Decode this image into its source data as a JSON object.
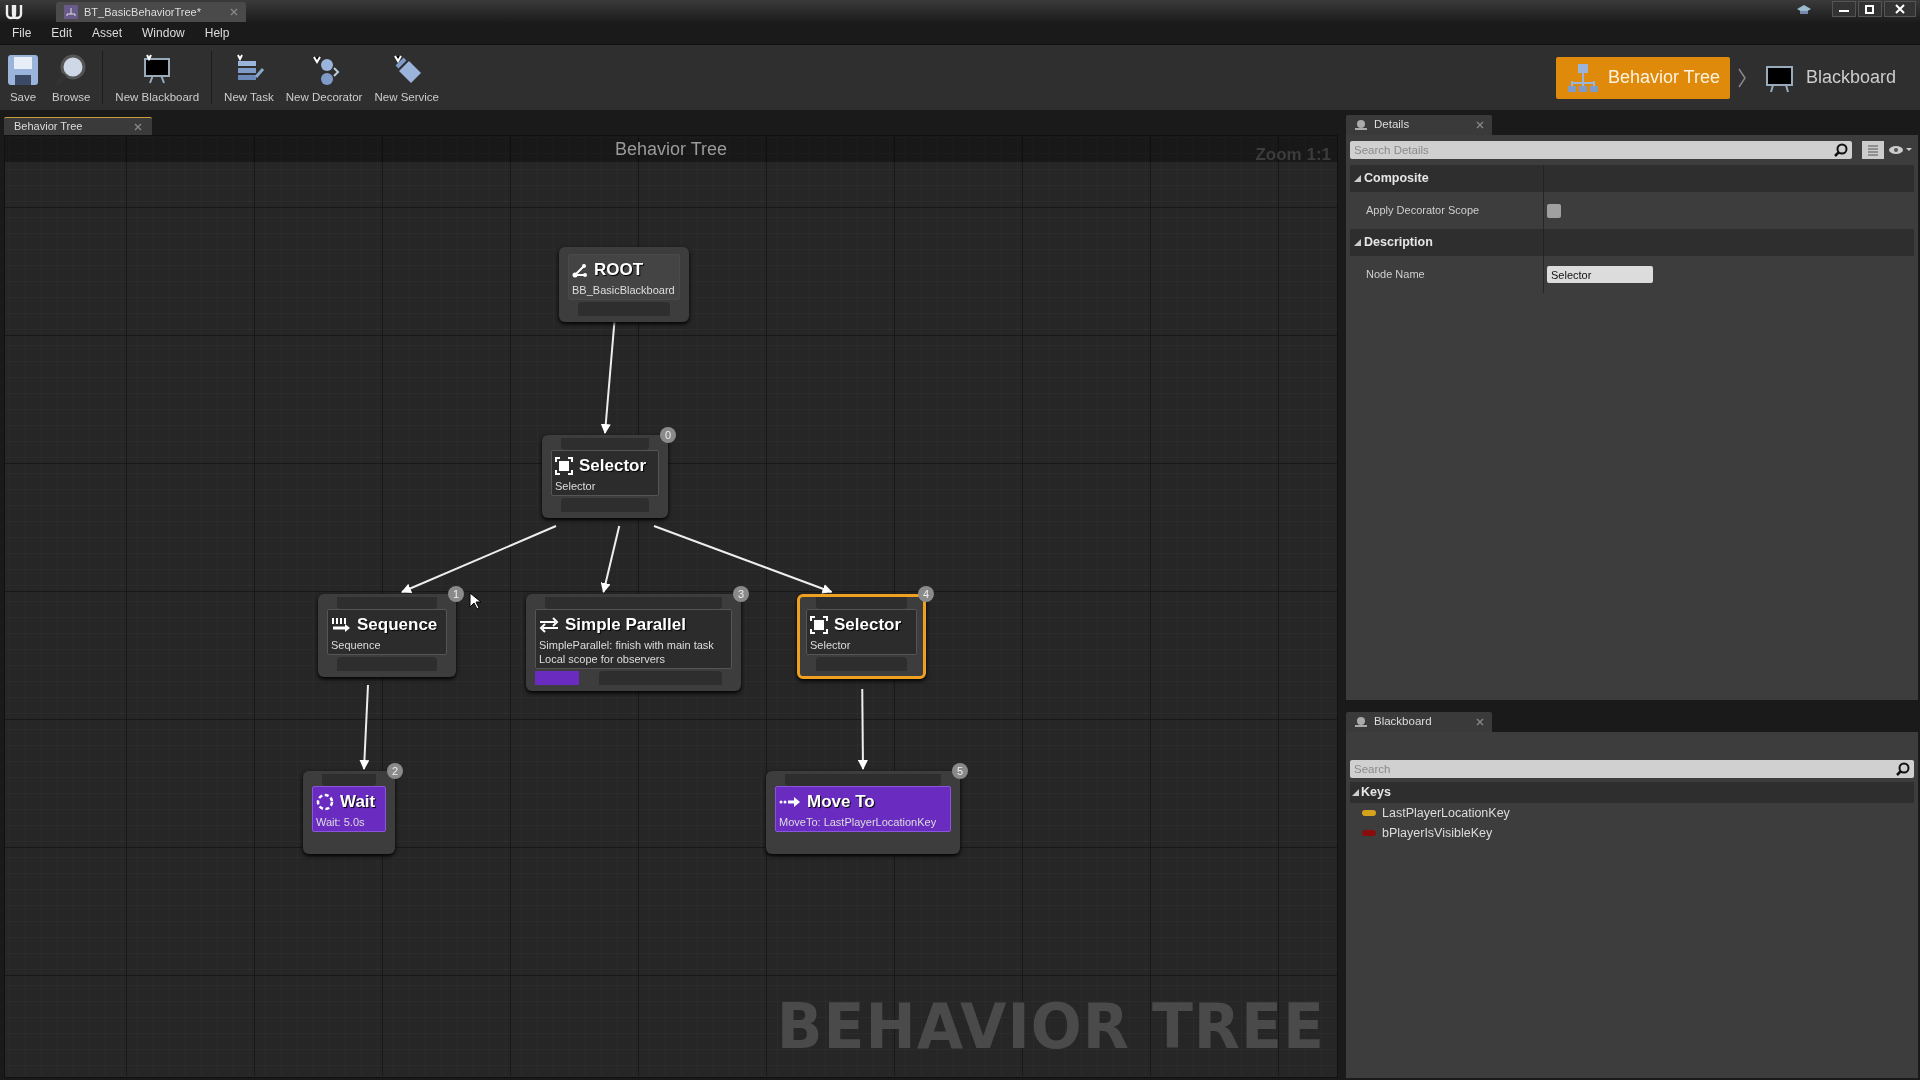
{
  "app_tab": {
    "title": "BT_BasicBehaviorTree*"
  },
  "menu": [
    "File",
    "Edit",
    "Asset",
    "Window",
    "Help"
  ],
  "toolbar": [
    {
      "label": "Save",
      "kind": "save"
    },
    {
      "label": "Browse",
      "kind": "browse"
    },
    {
      "label": "New Blackboard",
      "kind": "blackboard"
    },
    {
      "label": "New Task",
      "kind": "task"
    },
    {
      "label": "New Decorator",
      "kind": "decorator"
    },
    {
      "label": "New Service",
      "kind": "service"
    }
  ],
  "modes": [
    {
      "label": "Behavior Tree",
      "kind": "tree",
      "selected": true
    },
    {
      "label": "Blackboard",
      "kind": "blackboard",
      "selected": false
    }
  ],
  "graph": {
    "tab": "Behavior Tree",
    "title": "Behavior Tree",
    "zoom": "Zoom 1:1",
    "watermark": "BEHAVIOR TREE",
    "root": {
      "kind": "root",
      "title": "ROOT",
      "lines": [
        "BB_BasicBlackboard"
      ],
      "selected": false,
      "children": [
        {
          "kind": "selector",
          "index": "0",
          "title": "Selector",
          "lines": [
            "Selector"
          ],
          "selected": false,
          "children": [
            {
              "kind": "sequence",
              "index": "1",
              "title": "Sequence",
              "lines": [
                "Sequence"
              ],
              "selected": false,
              "children": [
                {
                  "kind": "wait",
                  "index": "2",
                  "title": "Wait",
                  "lines": [
                    "Wait: 5.0s"
                  ],
                  "selected": false
                }
              ]
            },
            {
              "kind": "parallel",
              "index": "3",
              "title": "Simple Parallel",
              "lines": [
                "SimpleParallel: finish with main task",
                "Local scope for observers"
              ],
              "selected": false
            },
            {
              "kind": "selector",
              "index": "4",
              "title": "Selector",
              "lines": [
                "Selector"
              ],
              "selected": true,
              "children": [
                {
                  "kind": "move_to",
                  "index": "5",
                  "title": "Move To",
                  "lines": [
                    "MoveTo: LastPlayerLocationKey"
                  ],
                  "selected": false
                }
              ]
            }
          ]
        }
      ]
    }
  },
  "details": {
    "tab": "Details",
    "search": {
      "placeholder": "Search Details"
    },
    "sections": [
      {
        "title": "Composite",
        "rows": [
          {
            "label": "Apply Decorator Scope",
            "kind": "checkbox",
            "checked": false
          }
        ]
      },
      {
        "title": "Description",
        "rows": [
          {
            "label": "Node Name",
            "kind": "text",
            "value": "Selector"
          }
        ]
      }
    ]
  },
  "blackboard": {
    "tab": "Blackboard",
    "search": {
      "placeholder": "Search"
    },
    "group": "Keys",
    "keys": [
      {
        "name": "LastPlayerLocationKey",
        "color": "#d4a21c"
      },
      {
        "name": "bPlayerIsVisibleKey",
        "color": "#8a0d0d"
      }
    ]
  }
}
